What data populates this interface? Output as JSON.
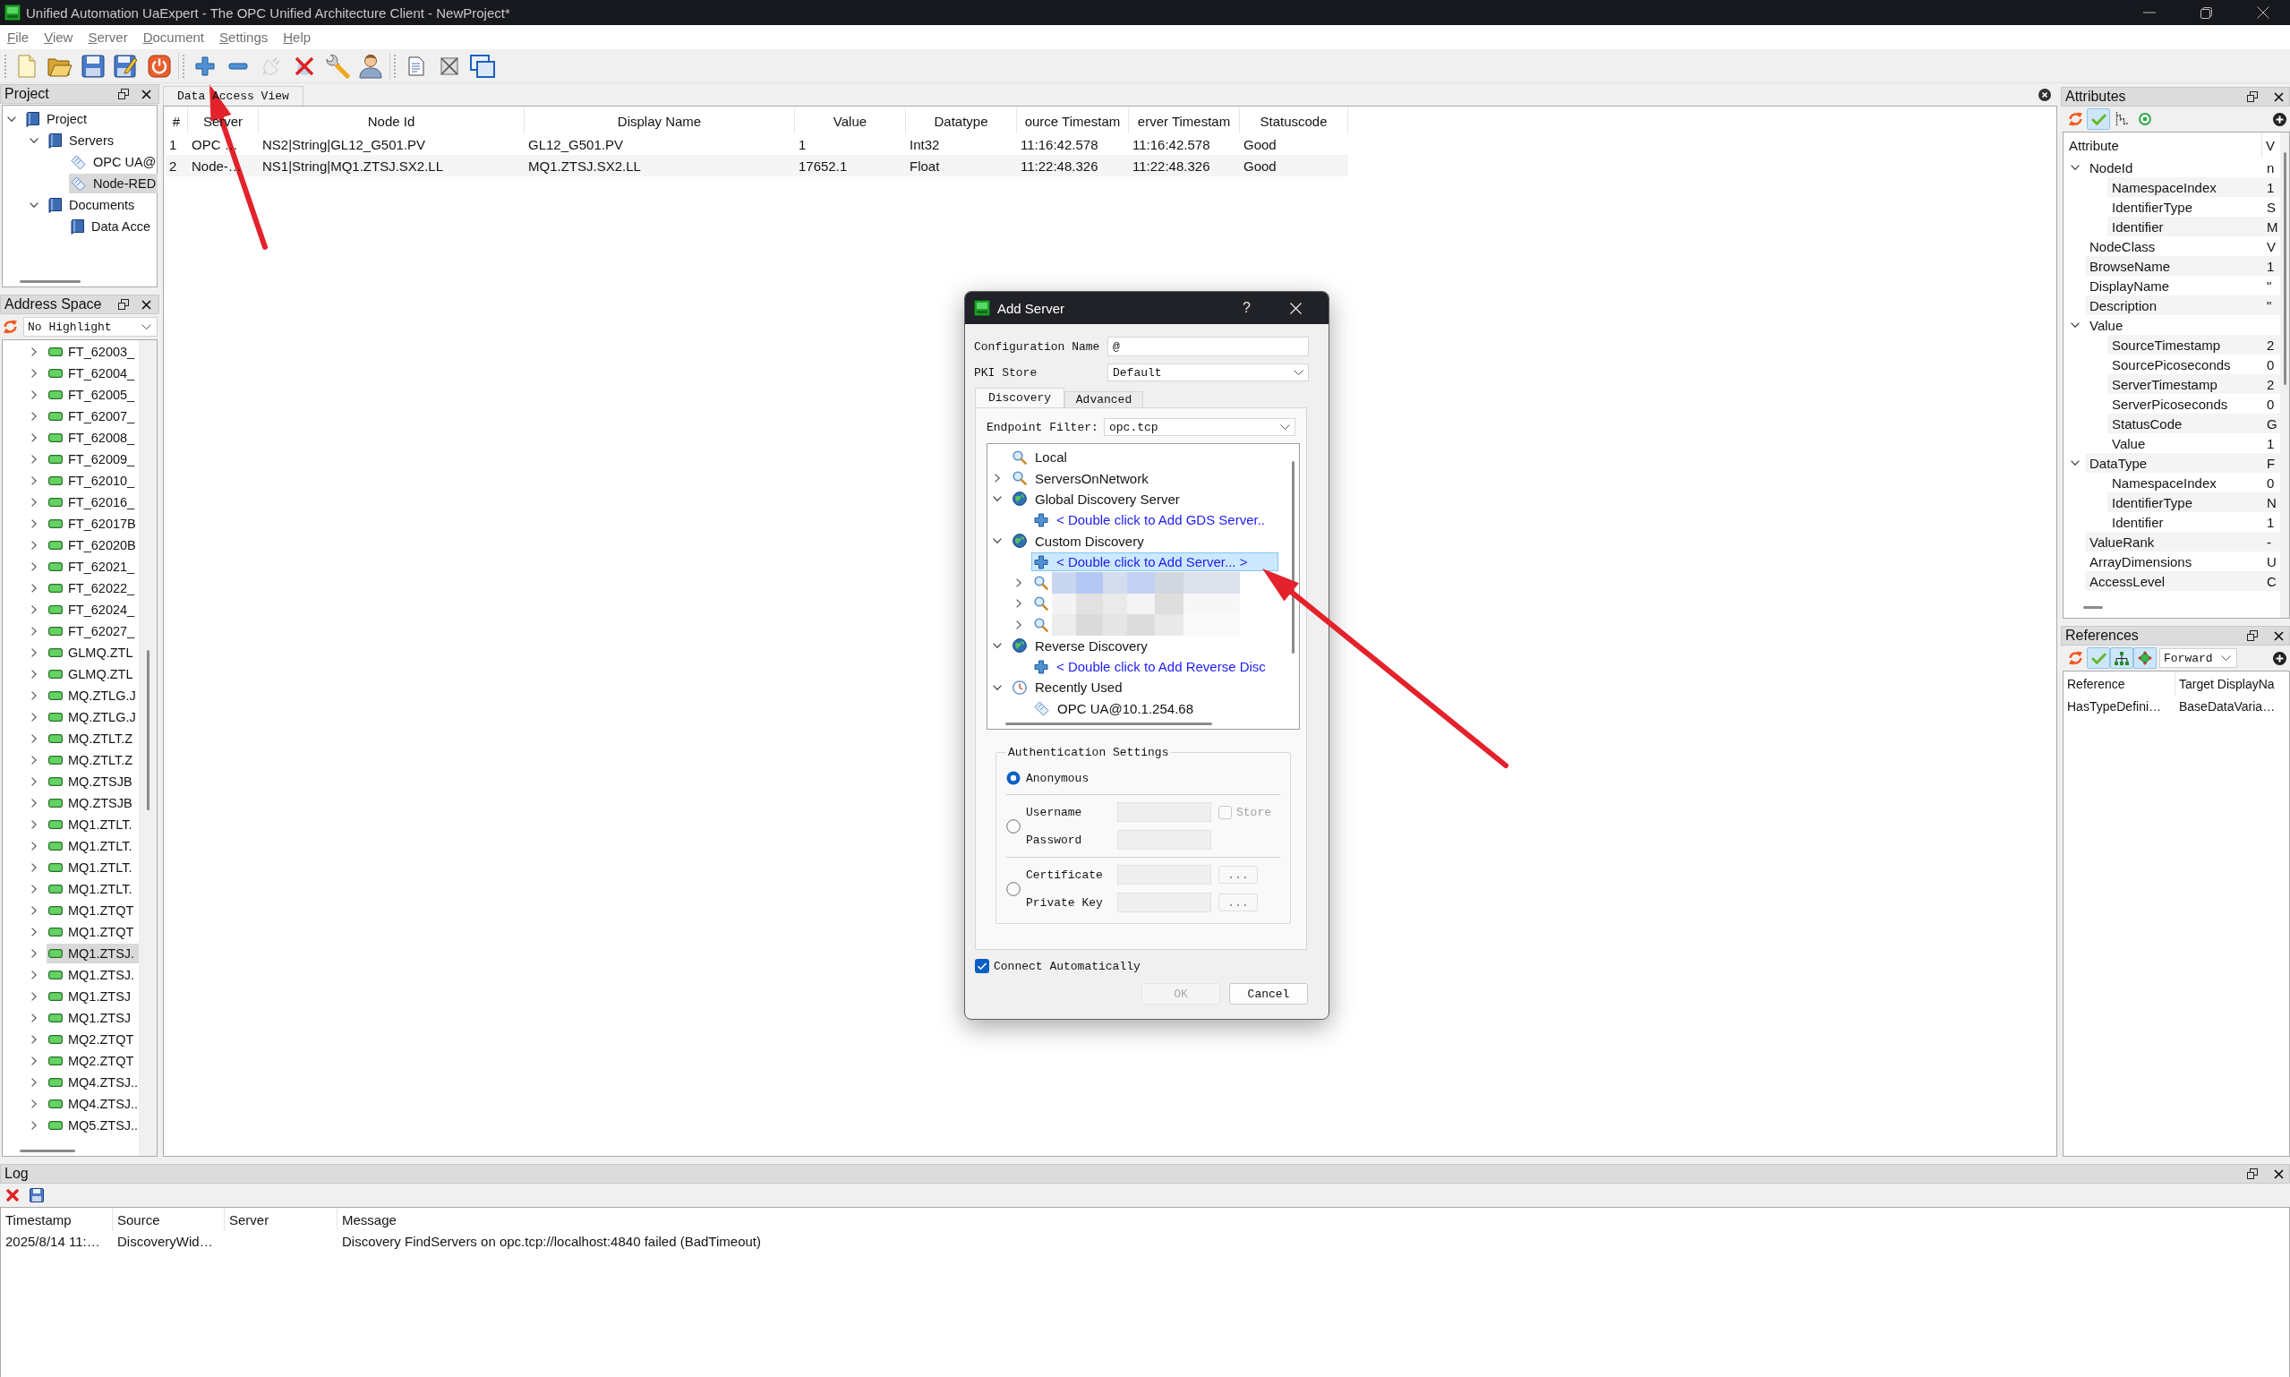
{
  "window": {
    "title": "Unified Automation UaExpert - The OPC Unified Architecture Client - NewProject*"
  },
  "menu": [
    "File",
    "View",
    "Server",
    "Document",
    "Settings",
    "Help"
  ],
  "toolbar": [
    [
      {
        "kind": "new",
        "disabled": false
      },
      {
        "kind": "open",
        "disabled": false
      },
      {
        "kind": "save",
        "disabled": false
      },
      {
        "kind": "save-as",
        "disabled": false
      },
      {
        "kind": "quit",
        "disabled": false
      }
    ],
    [
      {
        "kind": "add-server",
        "disabled": false
      },
      {
        "kind": "remove-server",
        "disabled": false
      },
      {
        "kind": "connect",
        "disabled": true
      },
      {
        "kind": "disconnect",
        "disabled": false
      },
      {
        "kind": "settings",
        "disabled": false
      },
      {
        "kind": "user",
        "disabled": false
      }
    ],
    [
      {
        "kind": "add-document",
        "disabled": false
      },
      {
        "kind": "remove-document",
        "disabled": false
      },
      {
        "kind": "windows",
        "disabled": false
      }
    ]
  ],
  "project": {
    "title": "Project",
    "tree": [
      {
        "label": "Project",
        "kind": "folder",
        "expanded": true,
        "selected": false,
        "children": [
          {
            "label": "Servers",
            "kind": "folder",
            "expanded": true,
            "selected": false,
            "children": [
              {
                "label": "OPC UA@",
                "kind": "server",
                "selected": false
              },
              {
                "label": "Node-RED",
                "kind": "server",
                "selected": true
              }
            ]
          },
          {
            "label": "Documents",
            "kind": "folder",
            "expanded": true,
            "selected": false,
            "children": [
              {
                "label": "Data Acce",
                "kind": "folder",
                "selected": false
              }
            ]
          }
        ]
      }
    ]
  },
  "address_space": {
    "title": "Address Space",
    "highlight_filter": "No Highlight",
    "items": [
      {
        "label": "FT_62003_",
        "expanded": false,
        "selected": false
      },
      {
        "label": "FT_62004_",
        "expanded": false,
        "selected": false
      },
      {
        "label": "FT_62005_",
        "expanded": false,
        "selected": false
      },
      {
        "label": "FT_62007_",
        "expanded": false,
        "selected": false
      },
      {
        "label": "FT_62008_",
        "expanded": false,
        "selected": false
      },
      {
        "label": "FT_62009_",
        "expanded": false,
        "selected": false
      },
      {
        "label": "FT_62010_",
        "expanded": false,
        "selected": false
      },
      {
        "label": "FT_62016_",
        "expanded": false,
        "selected": false
      },
      {
        "label": "FT_62017B",
        "expanded": false,
        "selected": false
      },
      {
        "label": "FT_62020B",
        "expanded": false,
        "selected": false
      },
      {
        "label": "FT_62021_",
        "expanded": false,
        "selected": false
      },
      {
        "label": "FT_62022_",
        "expanded": false,
        "selected": false
      },
      {
        "label": "FT_62024_",
        "expanded": false,
        "selected": false
      },
      {
        "label": "FT_62027_",
        "expanded": false,
        "selected": false
      },
      {
        "label": "GLMQ.ZTL",
        "expanded": false,
        "selected": false
      },
      {
        "label": "GLMQ.ZTL",
        "expanded": false,
        "selected": false
      },
      {
        "label": "MQ.ZTLG.J",
        "expanded": false,
        "selected": false
      },
      {
        "label": "MQ.ZTLG.J",
        "expanded": false,
        "selected": false
      },
      {
        "label": "MQ.ZTLT.Z",
        "expanded": false,
        "selected": false
      },
      {
        "label": "MQ.ZTLT.Z",
        "expanded": false,
        "selected": false
      },
      {
        "label": "MQ.ZTSJB",
        "expanded": false,
        "selected": false
      },
      {
        "label": "MQ.ZTSJB",
        "expanded": false,
        "selected": false
      },
      {
        "label": "MQ1.ZTLT.",
        "expanded": false,
        "selected": false
      },
      {
        "label": "MQ1.ZTLT.",
        "expanded": false,
        "selected": false
      },
      {
        "label": "MQ1.ZTLT.",
        "expanded": false,
        "selected": false
      },
      {
        "label": "MQ1.ZTLT.",
        "expanded": false,
        "selected": false
      },
      {
        "label": "MQ1.ZTQT",
        "expanded": false,
        "selected": false
      },
      {
        "label": "MQ1.ZTQT",
        "expanded": false,
        "selected": false
      },
      {
        "label": "MQ1.ZTSJ.",
        "expanded": false,
        "selected": true
      },
      {
        "label": "MQ1.ZTSJ.",
        "expanded": false,
        "selected": false
      },
      {
        "label": "MQ1.ZTSJ",
        "expanded": false,
        "selected": false
      },
      {
        "label": "MQ1.ZTSJ",
        "expanded": false,
        "selected": false
      },
      {
        "label": "MQ2.ZTQT",
        "expanded": false,
        "selected": false
      },
      {
        "label": "MQ2.ZTQT",
        "expanded": false,
        "selected": false
      },
      {
        "label": "MQ4.ZTSJ..",
        "expanded": false,
        "selected": false
      },
      {
        "label": "MQ4.ZTSJ..",
        "expanded": false,
        "selected": false
      },
      {
        "label": "MQ5.ZTSJ..",
        "expanded": false,
        "selected": false
      }
    ]
  },
  "documents": {
    "tabs": [
      {
        "label": "Data Access View",
        "selected": true
      }
    ],
    "table": {
      "columns": [
        "#",
        "Server",
        "Node Id",
        "Display Name",
        "Value",
        "Datatype",
        "ource Timestam",
        "erver Timestam",
        "Statuscode"
      ],
      "rows": [
        [
          "1",
          "OPC …",
          "NS2|String|GL12_G501.PV",
          "GL12_G501.PV",
          "1",
          "Int32",
          "11:16:42.578",
          "11:16:42.578",
          "Good"
        ],
        [
          "2",
          "Node-…",
          "NS1|String|MQ1.ZTSJ.SX2.LL",
          "MQ1.ZTSJ.SX2.LL",
          "17652.1",
          "Float",
          "11:22:48.326",
          "11:22:48.326",
          "Good"
        ]
      ]
    }
  },
  "attributes": {
    "title": "Attributes",
    "toolbar": [
      {
        "kind": "refresh",
        "on": false
      },
      {
        "kind": "filter",
        "on": true
      },
      {
        "kind": "tree",
        "on": false
      },
      {
        "kind": "monitor",
        "on": false
      }
    ],
    "columns": [
      "Attribute",
      "V"
    ],
    "rows": [
      {
        "name": "NodeId",
        "value": "n",
        "expanded": true,
        "children": [
          {
            "name": "NamespaceIndex",
            "value": "1"
          },
          {
            "name": "IdentifierType",
            "value": "S"
          },
          {
            "name": "Identifier",
            "value": "M"
          }
        ]
      },
      {
        "name": "NodeClass",
        "value": "V"
      },
      {
        "name": "BrowseName",
        "value": "1"
      },
      {
        "name": "DisplayName",
        "value": "\""
      },
      {
        "name": "Description",
        "value": "\""
      },
      {
        "name": "Value",
        "expanded": true,
        "children": [
          {
            "name": "SourceTimestamp",
            "value": "2"
          },
          {
            "name": "SourcePicoseconds",
            "value": "0"
          },
          {
            "name": "ServerTimestamp",
            "value": "2"
          },
          {
            "name": "ServerPicoseconds",
            "value": "0"
          },
          {
            "name": "StatusCode",
            "value": "G"
          },
          {
            "name": "Value",
            "value": "1"
          }
        ]
      },
      {
        "name": "DataType",
        "value": "F",
        "expanded": true,
        "children": [
          {
            "name": "NamespaceIndex",
            "value": "0"
          },
          {
            "name": "IdentifierType",
            "value": "N"
          },
          {
            "name": "Identifier",
            "value": "1"
          }
        ]
      },
      {
        "name": "ValueRank",
        "value": "-"
      },
      {
        "name": "ArrayDimensions",
        "value": "U"
      },
      {
        "name": "AccessLevel",
        "value": "C"
      }
    ]
  },
  "references": {
    "title": "References",
    "toolbar": [
      {
        "kind": "refresh",
        "on": false
      },
      {
        "kind": "filter",
        "on": true
      },
      {
        "kind": "hierarchy",
        "on": true
      },
      {
        "kind": "type-filter",
        "on": true
      }
    ],
    "direction": "Forward",
    "columns": [
      "Reference",
      "Target DisplayNa"
    ],
    "rows": [
      [
        "HasTypeDefini…",
        "BaseDataVaria…"
      ]
    ]
  },
  "log": {
    "title": "Log",
    "columns": [
      "Timestamp",
      "Source",
      "Server",
      "Message"
    ],
    "rows": [
      {
        "timestamp": "2025/8/14 11:…",
        "source": "DiscoveryWid…",
        "message": "Discovery FindServers on opc.tcp://localhost:4840 failed (BadTimeout)"
      }
    ]
  },
  "add_server_dialog": {
    "title": "Add Server",
    "help": "?",
    "configuration_name": {
      "label": "Configuration Name",
      "value": "@"
    },
    "pki_store": {
      "label": "PKI Store",
      "value": "Default"
    },
    "tabs": [
      {
        "label": "Discovery",
        "selected": true
      },
      {
        "label": "Advanced",
        "selected": false
      }
    ],
    "endpoint_filter": {
      "label": "Endpoint Filter:",
      "value": "opc.tcp"
    },
    "discovery_tree": [
      {
        "kind": "search",
        "label": "Local",
        "selected": false
      },
      {
        "kind": "search",
        "label": "ServersOnNetwork",
        "expanded": false,
        "selected": false
      },
      {
        "kind": "globe",
        "label": "Global Discovery Server",
        "expanded": true,
        "selected": false,
        "children": [
          {
            "kind": "add",
            "label": "< Double click to Add GDS Server..",
            "selected": false
          }
        ]
      },
      {
        "kind": "globe",
        "label": "Custom Discovery",
        "expanded": true,
        "selected": false,
        "children": [
          {
            "kind": "add",
            "label": "< Double click to Add Server... >",
            "selected": true
          },
          {
            "kind": "redacted",
            "expanded": false,
            "selected": false
          },
          {
            "kind": "redacted",
            "expanded": false,
            "selected": false
          },
          {
            "kind": "redacted",
            "expanded": false,
            "selected": false
          }
        ]
      },
      {
        "kind": "globe",
        "label": "Reverse Discovery",
        "expanded": true,
        "selected": false,
        "children": [
          {
            "kind": "add",
            "label": "< Double click to Add Reverse Disc",
            "selected": false
          }
        ]
      },
      {
        "kind": "clock",
        "label": "Recently Used",
        "expanded": true,
        "selected": false,
        "children": [
          {
            "kind": "server",
            "label": "OPC UA@10.1.254.68",
            "selected": false
          }
        ]
      }
    ],
    "authentication": {
      "title": "Authentication Settings",
      "options": [
        {
          "kind": "anonymous",
          "label": "Anonymous",
          "selected": true
        },
        {
          "kind": "user",
          "selected": false,
          "fields": [
            {
              "label": "Username",
              "disabled": true,
              "store": {
                "label": "Store",
                "checked": false,
                "disabled": true
              }
            },
            {
              "label": "Password",
              "disabled": true
            }
          ]
        },
        {
          "kind": "certificate",
          "selected": false,
          "fields": [
            {
              "label": "Certificate",
              "disabled": true,
              "browse": {
                "label": "...",
                "disabled": true
              }
            },
            {
              "label": "Private Key",
              "disabled": true,
              "browse": {
                "label": "...",
                "disabled": true
              }
            }
          ]
        }
      ]
    },
    "connect_automatically": {
      "label": "Connect Automatically",
      "checked": true
    },
    "buttons": [
      {
        "label": "OK",
        "disabled": true
      },
      {
        "label": "Cancel",
        "disabled": false
      }
    ]
  }
}
